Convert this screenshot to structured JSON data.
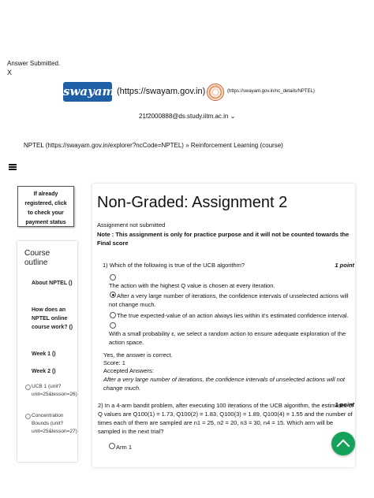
{
  "header": {
    "answer_submitted": "Answer Submitted.",
    "close_label": "X",
    "swayam_logo_text": "swayam",
    "swayam_link": "(https://swayam.gov.in)",
    "nptel_link": "(https://swayam.gov.in/nc_details/NPTEL)",
    "user_email": "21f2000888@ds.study.iitm.ac.in ⌄"
  },
  "breadcrumb": {
    "text": "NPTEL (https://swayam.gov.in/explorer?ncCode=NPTEL)  »  Reinforcement Learning (course)"
  },
  "sidebar": {
    "registered_box": [
      "If already",
      "registered, click",
      "to check your",
      "payment status"
    ],
    "course_outline_title": "Course outline",
    "items": [
      {
        "label": "About NPTEL ()"
      },
      {
        "label": "How does an NPTEL online course work? ()"
      },
      {
        "label": "Week 1 ()"
      },
      {
        "label": "Week 2 ()"
      }
    ],
    "subitems": [
      {
        "label": "UCB 1 (unit?unit=25&lesson=26)"
      },
      {
        "label": "Concentration Bounds (unit?unit=25&lesson=27)"
      }
    ]
  },
  "main": {
    "title": "Non-Graded: Assignment 2",
    "status": "Assignment not submitted",
    "note": "Note : This assignment is only for practice purpose and it will not be counted towards the Final score",
    "q1": {
      "question": "1)  Which of the following is true of the UCB algorithm?",
      "points": "1 point",
      "options": [
        "The action with the highest Q value is chosen at every iteration.",
        "After a very large number of iterations, the confidence intervals of unselected actions will not change much.",
        "The true expected-value of an action always lies within it's estimated confidence interval.",
        "With a small probability ε, we select a random action to ensure adequate exploration of the action space."
      ],
      "feedback_line1": "Yes, the answer is correct.",
      "feedback_line2": "Score: 1",
      "accepted_label": "Accepted Answers:",
      "accepted_answer": "After a very large number of iterations, the confidence intervals of unselected actions will not change much."
    },
    "q2": {
      "question": "2)  In a 4-arm bandit problem, after executing 100 iterations of the UCB algorithm, the estimates of Q values are Q100(1) = 1.73, Q100(2) = 1.83, Q100(3) = 1.89, Q100(4) = 1.55 and the number of times each of them are sampled are n1 = 25, n2 = 20, n3 = 30, n4 = 15. Which arm will be sampled in the next trial?",
      "points": "1 point",
      "option1": "Arm 1"
    }
  },
  "colors": {
    "scroll_button": "#15a05b",
    "swayam_logo": "#1f5fa8"
  }
}
